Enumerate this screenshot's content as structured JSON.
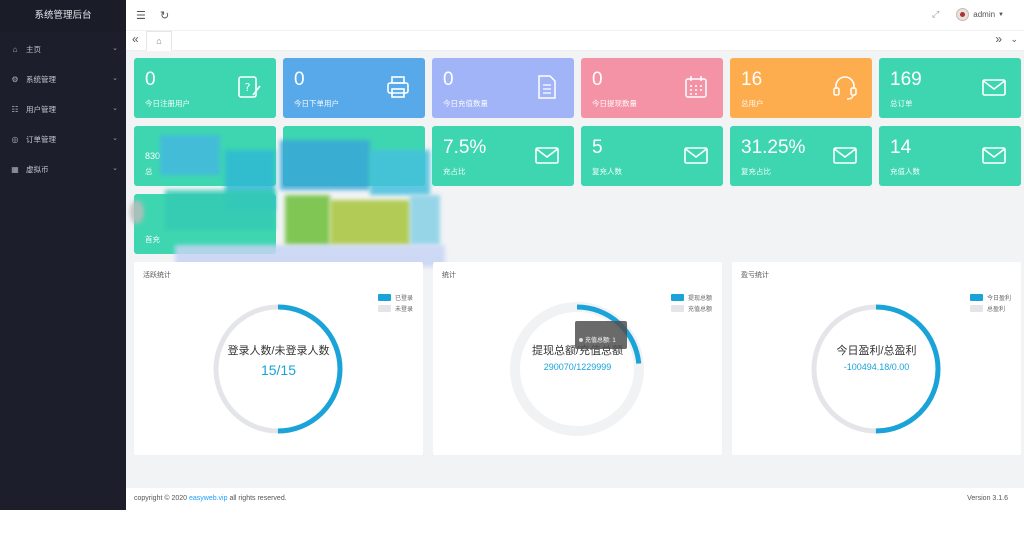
{
  "sidebar": {
    "brand": "系统管理后台",
    "items": [
      {
        "label": "主页",
        "icon": "home-icon"
      },
      {
        "label": "系统管理",
        "icon": "gear-icon"
      },
      {
        "label": "用户管理",
        "icon": "user-icon"
      },
      {
        "label": "订单管理",
        "icon": "order-icon"
      },
      {
        "label": "虚拟币",
        "icon": "coin-icon"
      }
    ]
  },
  "header": {
    "user": "admin"
  },
  "stats": [
    {
      "value": "0",
      "label": "今日注册用户",
      "color": "#3dd6b0"
    },
    {
      "value": "0",
      "label": "今日下单用户",
      "color": "#57a9ea"
    },
    {
      "value": "0",
      "label": "今日充值数量",
      "color": "#a2b4f8"
    },
    {
      "value": "0",
      "label": "今日提现数量",
      "color": "#f593a6"
    },
    {
      "value": "16",
      "label": "总用户",
      "color": "#fdac4e"
    },
    {
      "value": "169",
      "label": "总订单",
      "color": "#3dd6b0"
    },
    {
      "value": "830",
      "label": "总",
      "color": "#3dd6b0"
    },
    {
      "value": "7.5%",
      "label": "充占比",
      "color": "#3dd6b0"
    },
    {
      "value": "5",
      "label": "复充人数",
      "color": "#3dd6b0"
    },
    {
      "value": "31.25%",
      "label": "复充占比",
      "color": "#3dd6b0"
    },
    {
      "value": "14",
      "label": "充值人数",
      "color": "#3dd6b0"
    },
    {
      "value": "",
      "label": "首充",
      "color": "#3dd6b0"
    }
  ],
  "panels": [
    {
      "title": "活跃统计",
      "main": "登录人数/未登录人数",
      "value": "15/15",
      "legend": [
        "已登录",
        "未登录"
      ],
      "fraction": 0.5
    },
    {
      "title": "统计",
      "main": "提现总额/充值总额",
      "value": "290070/1229999",
      "legend": [
        "提现总额",
        "充值总额"
      ],
      "fraction": 0.236
    },
    {
      "title": "盈亏统计",
      "main": "今日盈利/总盈利",
      "value": "-100494.18/0.00",
      "legend": [
        "今日盈利",
        "总盈利"
      ],
      "fraction": 0.5
    }
  ],
  "tooltip": "充值总额: 1",
  "colors": {
    "accent": "#1aa3d9",
    "track": "#e3e5e8",
    "sidebar": "#1c1f2b"
  },
  "footer": {
    "copy_prefix": "copyright © 2020",
    "copy_link": "easyweb.vip",
    "copy_suffix": "all rights reserved.",
    "version": "Version 3.1.6"
  }
}
